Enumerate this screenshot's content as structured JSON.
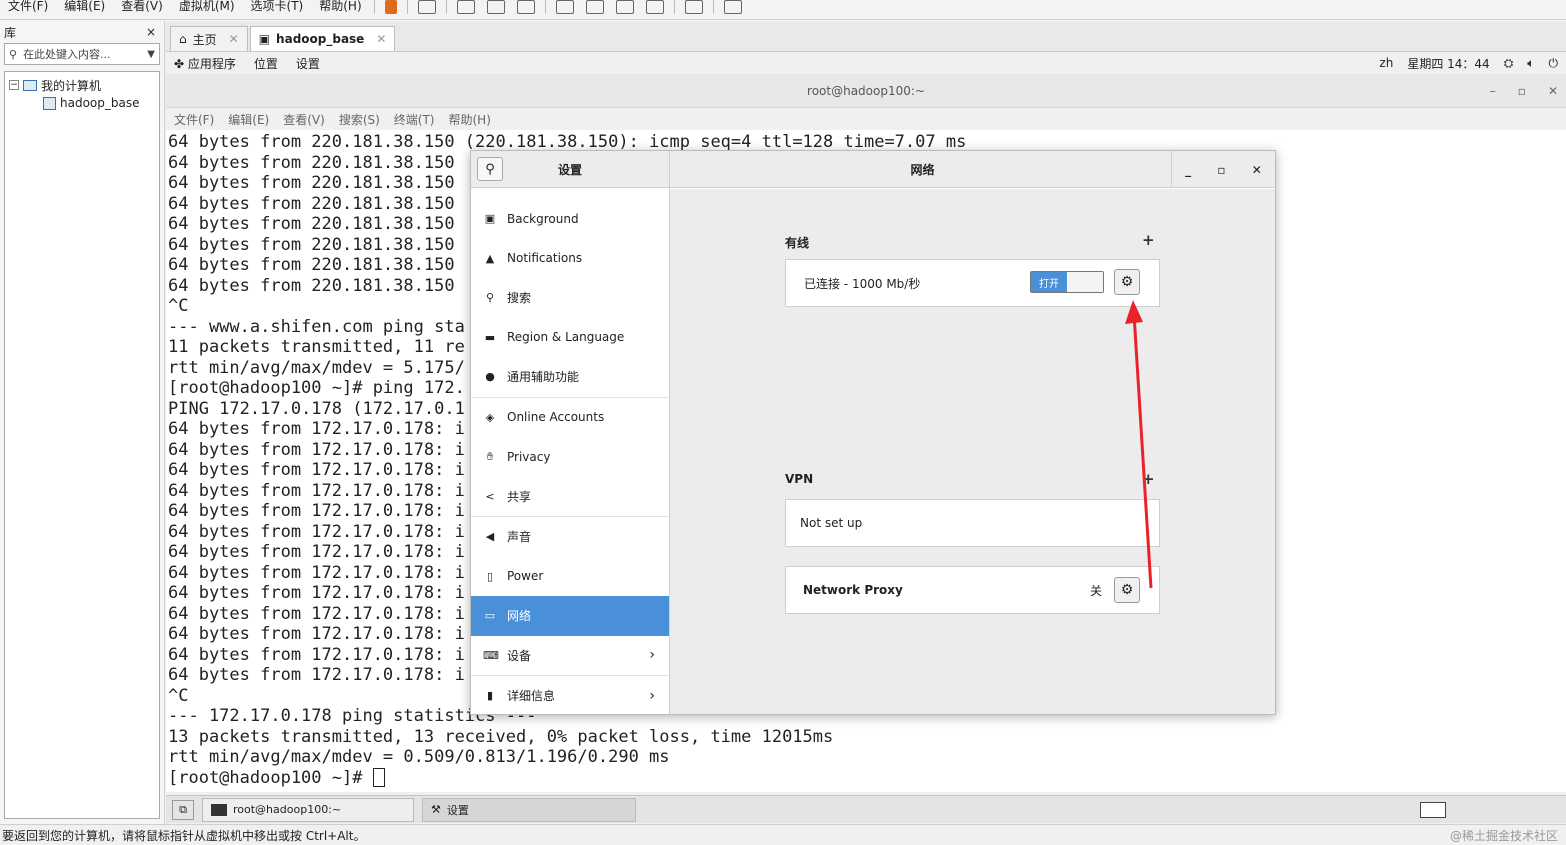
{
  "vm_menu": [
    "文件(F)",
    "编辑(E)",
    "查看(V)",
    "虚拟机(M)",
    "选项卡(T)",
    "帮助(H)"
  ],
  "library": {
    "title": "库",
    "close": "×",
    "search_placeholder": "在此处键入内容...",
    "tree_root": "我的计算机",
    "tree_child": "hadoop_base"
  },
  "vm_tabs": [
    {
      "label": "主页"
    },
    {
      "label": "hadoop_base"
    }
  ],
  "gnome": {
    "apps": "应用程序",
    "places": "位置",
    "settings": "设置",
    "lang": "zh",
    "clock": "星期四 14：44"
  },
  "terminal": {
    "title": "root@hadoop100:~",
    "menu": [
      "文件(F)",
      "编辑(E)",
      "查看(V)",
      "搜索(S)",
      "终端(T)",
      "帮助(H)"
    ],
    "lines": [
      "64 bytes from 220.181.38.150 (220.181.38.150): icmp_seq=4 ttl=128 time=7.07 ms",
      "64 bytes from 220.181.38.150",
      "64 bytes from 220.181.38.150",
      "64 bytes from 220.181.38.150",
      "64 bytes from 220.181.38.150",
      "64 bytes from 220.181.38.150",
      "64 bytes from 220.181.38.150",
      "64 bytes from 220.181.38.150",
      "^C",
      "--- www.a.shifen.com ping sta",
      "11 packets transmitted, 11 re",
      "rtt min/avg/max/mdev = 5.175/",
      "[root@hadoop100 ~]# ping 172.",
      "PING 172.17.0.178 (172.17.0.1",
      "64 bytes from 172.17.0.178: i",
      "64 bytes from 172.17.0.178: i",
      "64 bytes from 172.17.0.178: i",
      "64 bytes from 172.17.0.178: i",
      "64 bytes from 172.17.0.178: i",
      "64 bytes from 172.17.0.178: i",
      "64 bytes from 172.17.0.178: i",
      "64 bytes from 172.17.0.178: i",
      "64 bytes from 172.17.0.178: i",
      "64 bytes from 172.17.0.178: i",
      "64 bytes from 172.17.0.178: i",
      "64 bytes from 172.17.0.178: i",
      "64 bytes from 172.17.0.178: i",
      "^C",
      "--- 172.17.0.178 ping statistics ---",
      "13 packets transmitted, 13 received, 0% packet loss, time 12015ms",
      "rtt min/avg/max/mdev = 0.509/0.813/1.196/0.290 ms",
      "[root@hadoop100 ~]# "
    ]
  },
  "settings": {
    "title_left": "设置",
    "title_right": "网络",
    "sidebar": [
      {
        "label": "Background",
        "icon": "image-icon"
      },
      {
        "label": "Notifications",
        "icon": "bell-icon"
      },
      {
        "label": "搜索",
        "icon": "search-icon"
      },
      {
        "label": "Region & Language",
        "icon": "flag-icon"
      },
      {
        "label": "通用辅助功能",
        "icon": "accessibility-icon"
      },
      {
        "label": "Online Accounts",
        "icon": "accounts-icon"
      },
      {
        "label": "Privacy",
        "icon": "hand-icon"
      },
      {
        "label": "共享",
        "icon": "share-icon"
      },
      {
        "label": "声音",
        "icon": "speaker-icon"
      },
      {
        "label": "Power",
        "icon": "power-icon"
      },
      {
        "label": "网络",
        "icon": "network-icon"
      },
      {
        "label": "设备",
        "icon": "devices-icon"
      },
      {
        "label": "详细信息",
        "icon": "info-icon"
      }
    ],
    "wired": {
      "title": "有线",
      "status": "已连接 - 1000 Mb/秒",
      "switch_label": "打开"
    },
    "vpn": {
      "title": "VPN",
      "status": "Not set up"
    },
    "proxy": {
      "label": "Network Proxy",
      "status": "关"
    },
    "colors": {
      "accent": "#4a90d9",
      "arrow": "#e8232a"
    }
  },
  "taskbar": {
    "task1": "root@hadoop100:~",
    "task2": "设置"
  },
  "statusbar": {
    "text": "要返回到您的计算机，请将鼠标指针从虚拟机中移出或按 Ctrl+Alt。",
    "watermark": "@稀土掘金技术社区"
  }
}
